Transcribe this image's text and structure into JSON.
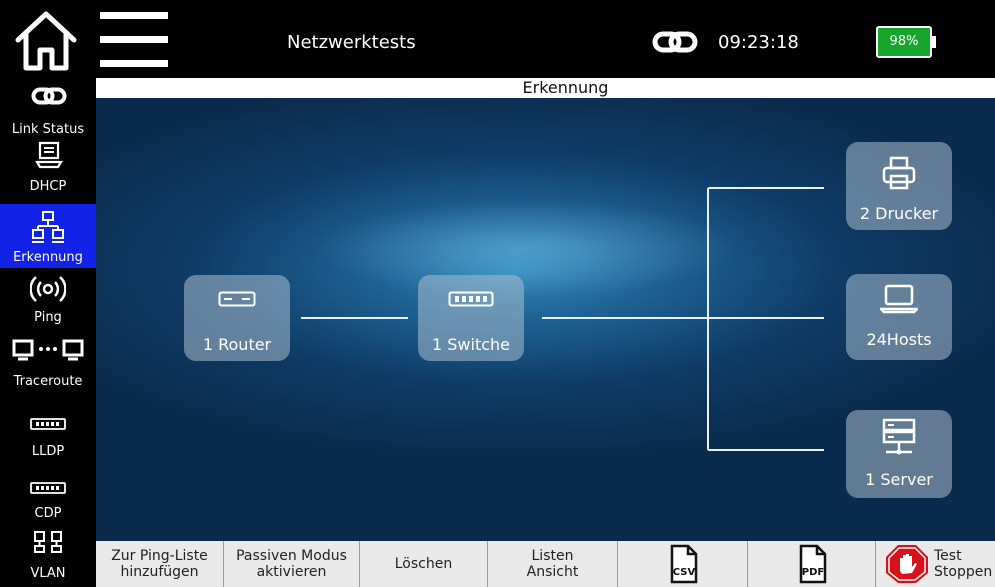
{
  "header": {
    "title": "Netzwerktests",
    "time": "09:23:18",
    "battery": "98%",
    "battery_color": "#18a52c"
  },
  "section": {
    "title": "Erkennung"
  },
  "sidebar": {
    "items": [
      {
        "label": "Link Status",
        "icon": "link-icon"
      },
      {
        "label": "DHCP",
        "icon": "dhcp-server-icon"
      },
      {
        "label": "Erkennung",
        "icon": "network-tree-icon",
        "active": true
      },
      {
        "label": "Ping",
        "icon": "broadcast-icon"
      },
      {
        "label": "Traceroute",
        "icon": "traceroute-icon"
      },
      {
        "label": "LLDP",
        "icon": "switch-icon"
      },
      {
        "label": "CDP",
        "icon": "switch-icon"
      },
      {
        "label": "VLAN",
        "icon": "vlan-icon"
      }
    ],
    "active_color": "#1222e8"
  },
  "topology": {
    "router": "1 Router",
    "switch": "1 Switche",
    "printers": "2 Drucker",
    "hosts": "24Hosts",
    "servers": "1 Server"
  },
  "toolbar": {
    "ping_list": [
      "Zur Ping-Liste",
      "hinzufügen"
    ],
    "passive_mode": [
      "Passiven Modus",
      "aktivieren"
    ],
    "delete": "Löschen",
    "list_view": [
      "Listen",
      "Ansicht"
    ],
    "csv": "CSV",
    "pdf": "PDF",
    "stop": [
      "Test",
      "Stoppen"
    ]
  }
}
